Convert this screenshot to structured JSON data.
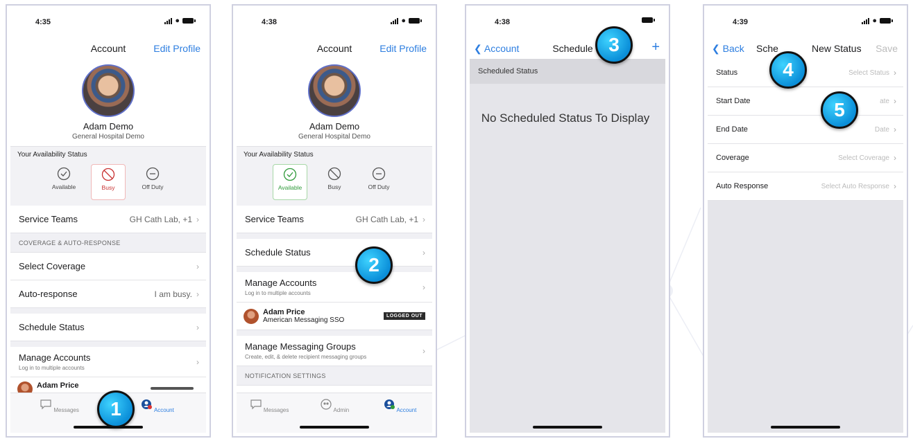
{
  "colors": {
    "accent": "#2d7ee0",
    "badge": "#1aa7ec",
    "busy": "#c83232",
    "available": "#2f9a3a"
  },
  "screen1": {
    "time": "4:35",
    "title": "Account",
    "edit_profile": "Edit Profile",
    "user_name": "Adam Demo",
    "user_org": "General Hospital Demo",
    "availability_header": "Your Availability Status",
    "availability_options": [
      "Available",
      "Busy",
      "Off Duty"
    ],
    "service_teams_label": "Service Teams",
    "service_teams_value": "GH Cath Lab, +1",
    "section_coverage": "COVERAGE & AUTO-RESPONSE",
    "select_coverage": "Select Coverage",
    "auto_response_label": "Auto-response",
    "auto_response_value": "I am busy.",
    "schedule_status": "Schedule Status",
    "manage_accounts": "Manage Accounts",
    "manage_accounts_sub": "Log in to multiple accounts",
    "account_name": "Adam Price",
    "tabs": [
      "Messages",
      "Account"
    ],
    "badge": "1"
  },
  "screen2": {
    "time": "4:38",
    "title": "Account",
    "edit_profile": "Edit Profile",
    "user_name": "Adam Demo",
    "user_org": "General Hospital Demo",
    "availability_header": "Your Availability Status",
    "availability_options": [
      "Available",
      "Busy",
      "Off Duty"
    ],
    "service_teams_label": "Service Teams",
    "service_teams_value": "GH Cath Lab, +1",
    "schedule_status": "Schedule Status",
    "manage_accounts": "Manage Accounts",
    "manage_accounts_sub": "Log in to multiple accounts",
    "account_name": "Adam Price",
    "account_org": "American Messaging SSO",
    "logged_out": "LOGGED OUT",
    "manage_groups": "Manage Messaging Groups",
    "manage_groups_sub": "Create, edit, & delete recipient messaging groups",
    "section_notification": "NOTIFICATION SETTINGS",
    "tabs": [
      "Messages",
      "Admin",
      "Account"
    ],
    "badge": "2"
  },
  "screen3": {
    "time": "4:38",
    "back": "Account",
    "title": "Schedule Sta",
    "add": "+",
    "section": "Scheduled Status",
    "empty": "No Scheduled Status To Display",
    "badge": "3"
  },
  "screen4": {
    "time": "4:39",
    "back": "Back",
    "title_left": "Sche",
    "title_right": "New Status",
    "save": "Save",
    "rows": [
      {
        "label": "Status",
        "value": "Select Status"
      },
      {
        "label": "Start Date",
        "value": "ate"
      },
      {
        "label": "End Date",
        "value": "Date"
      },
      {
        "label": "Coverage",
        "value": "Select Coverage"
      },
      {
        "label": "Auto Response",
        "value": "Select Auto Response"
      }
    ],
    "badges": [
      "4",
      "5"
    ]
  }
}
